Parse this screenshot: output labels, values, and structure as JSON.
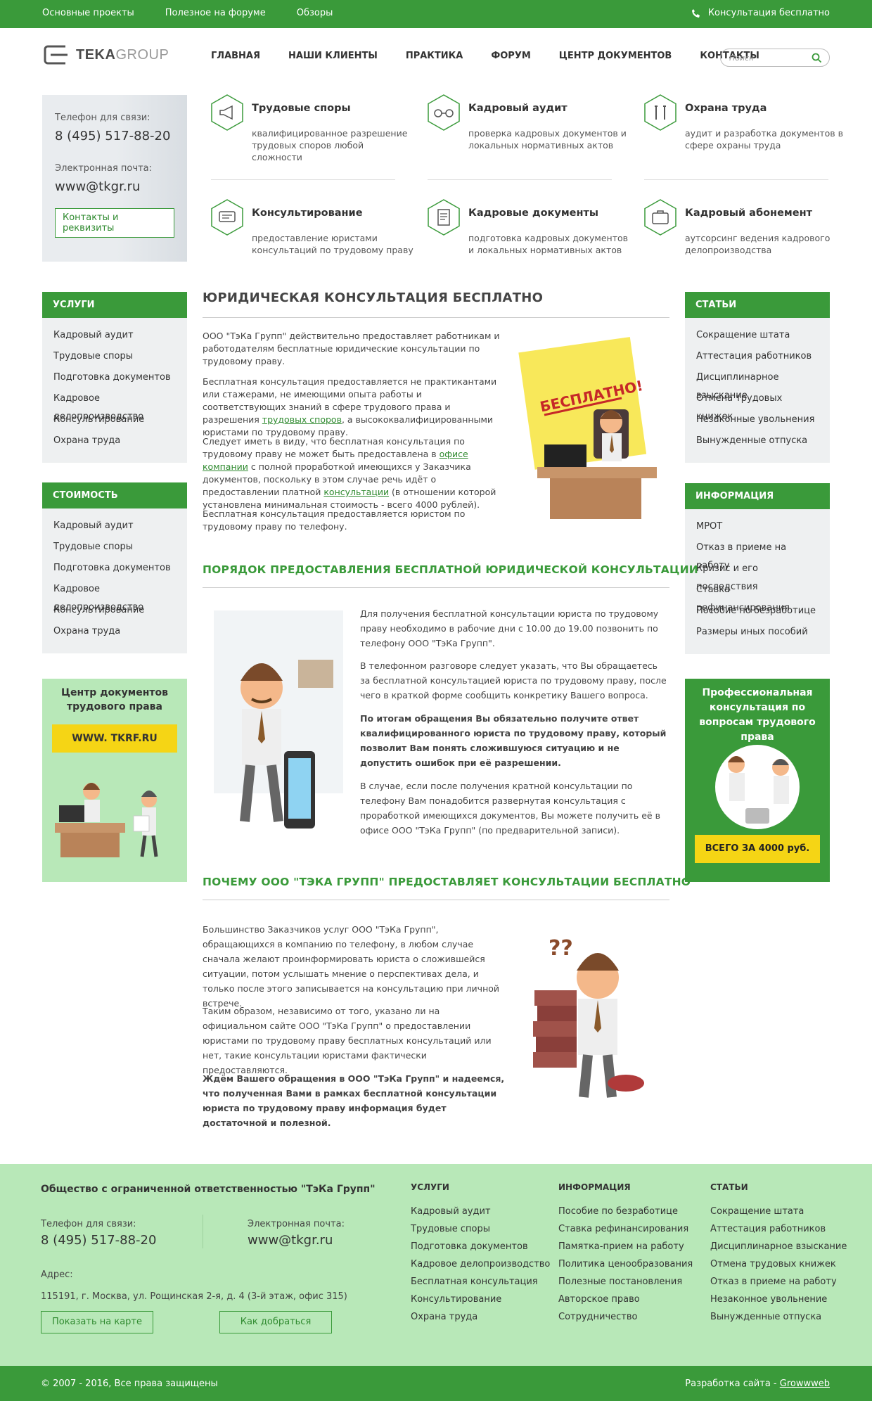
{
  "topbar": {
    "links": [
      "Основные проекты",
      "Полезное на форуме",
      "Обзоры"
    ],
    "consult": "Консультация бесплатно"
  },
  "logo": {
    "part1": "TEKA",
    "part2": "GROUP"
  },
  "nav": [
    "ГЛАВНАЯ",
    "НАШИ КЛИЕНТЫ",
    "ПРАКТИКА",
    "ФОРУМ",
    "ЦЕНТР ДОКУМЕНТОВ",
    "КОНТАКТЫ"
  ],
  "search": {
    "placeholder": "Поиск"
  },
  "contact": {
    "phone_label": "Телефон для связи:",
    "phone": "8 (495) 517-88-20",
    "email_label": "Электронная почта:",
    "email": "www@tkgr.ru",
    "button": "Контакты и реквизиты"
  },
  "services": [
    {
      "title": "Трудовые споры",
      "desc": "квалифицированное разрешение трудовых споров любой сложности",
      "icon": "megaphone-icon"
    },
    {
      "title": "Кадровый аудит",
      "desc": "проверка кадровых документов и локальных нормативных актов",
      "icon": "glasses-icon"
    },
    {
      "title": "Охрана труда",
      "desc": "аудит и разработка документов в сфере охраны труда",
      "icon": "tools-icon"
    },
    {
      "title": "Консультирование",
      "desc": "предоставление юристами консультаций по трудовому праву",
      "icon": "chat-icon"
    },
    {
      "title": "Кадровые документы",
      "desc": "подготовка кадровых документов и локальных нормативных актов",
      "icon": "document-icon"
    },
    {
      "title": "Кадровый абонемент",
      "desc": "аутсорсинг ведения кадрового делопроизводства",
      "icon": "briefcase-icon"
    }
  ],
  "left_sidebar": {
    "services": {
      "title": "УСЛУГИ",
      "items": [
        "Кадровый аудит",
        "Трудовые споры",
        "Подготовка документов",
        "Кадровое делопроизводство",
        "Консультирование",
        "Охрана труда"
      ]
    },
    "cost": {
      "title": "СТОИМОСТЬ",
      "items": [
        "Кадровый аудит",
        "Трудовые споры",
        "Подготовка документов",
        "Кадровое делопроизводство",
        "Консультирование",
        "Охрана труда"
      ]
    },
    "banner": {
      "title": "Центр документов трудового права",
      "site": "WWW. TKRF.RU"
    }
  },
  "right_sidebar": {
    "articles": {
      "title": "СТАТЬИ",
      "items": [
        "Сокращение штата",
        "Аттестация работников",
        "Дисциплинарное взыскание",
        "Отмена трудовых книжек",
        "Незаконные увольнения",
        "Вынужденные отпуска"
      ]
    },
    "info": {
      "title": "ИНФОРМАЦИЯ",
      "items": [
        "МРОТ",
        "Отказ в приеме на работу",
        "Кризис и его последствия",
        "Ставка рефинансирования",
        "Пособие по безработице",
        "Размеры иных пособий"
      ]
    },
    "banner": {
      "title": "Профессиональная консультация по вопросам трудового права",
      "price": "ВСЕГО ЗА 4000 руб."
    }
  },
  "article": {
    "title": "ЮРИДИЧЕСКАЯ КОНСУЛЬТАЦИЯ БЕСПЛАТНО",
    "sticker": "БЕСПЛАТНО!",
    "p1": "ООО \"ТэКа Групп\" действительно предоставляет работникам и работодателям бесплатные юридические консультации по трудовому праву.",
    "p2a": "Бесплатная консультация предоставляется не практикантами или стажерами, не имеющими опыта работы и соответствующих знаний в сфере трудового права и разрешения ",
    "p2link": "трудовых споров",
    "p2b": ", а высококвалифицированными юристами по трудовому праву.",
    "p3a": "Следует иметь в виду, что бесплатная консультация по трудовому праву не может быть предоставлена в ",
    "p3link1": "офисе компании",
    "p3b": " с полной проработкой имеющихся у Заказчика документов, поскольку в этом случае речь идёт о предоставлении платной ",
    "p3link2": "консультации",
    "p3c": " (в отношении которой установлена минимальная стоимость - всего 4000 рублей).",
    "p4": "Бесплатная консультация предоставляется юристом по трудовому праву по телефону.",
    "h2a": "ПОРЯДОК ПРЕДОСТАВЛЕНИЯ БЕСПЛАТНОЙ ЮРИДИЧЕСКОЙ КОНСУЛЬТАЦИИ",
    "p5": " Для получения бесплатной консультации юриста по трудовому праву необходимо в рабочие дни с 10.00 до 19.00 позвонить по телефону ООО \"ТэКа Групп\".",
    "p6": "В телефонном разговоре следует указать, что Вы обращаетесь за бесплатной консультацией юриста по трудовому праву, после чего в краткой форме сообщить конкретику Вашего вопроса.",
    "p7": "По итогам обращения Вы обязательно получите ответ квалифицированного юриста по трудовому праву, который позволит Вам понять сложившуюся ситуацию и не допустить ошибок при её разрешении.",
    "p8": "В случае, если после получения кратной консультации по телефону Вам понадобится развернутая консультация с проработкой имеющихся документов, Вы можете получить её в офисе ООО \"ТэКа Групп\" (по предварительной записи).",
    "h2b": "ПОЧЕМУ ООО \"ТЭКА ГРУПП\" ПРЕДОСТАВЛЯЕТ КОНСУЛЬТАЦИИ БЕСПЛАТНО",
    "p9": " Большинство Заказчиков услуг ООО \"ТэКа Групп\", обращающихся в компанию по телефону, в любом случае сначала желают проинформировать юриста о сложившейся ситуации, потом услышать мнение о перспективах  дела, и только после этого записывается на консультацию при личной встрече.",
    "p10": "Таким образом, независимо от того, указано ли на официальном сайте ООО \"ТэКа Групп\" о предоставлении юристами по трудовому праву бесплатных консультаций или нет, такие консультации юристами фактически предоставляются.",
    "p11": "Ждём Вашего обращения в ООО \"ТэКа Групп\" и надеемся, что полученная Вами в рамках бесплатной консультации юриста по трудовому праву информация будет достаточной и полезной."
  },
  "footer": {
    "company": "Общество с ограниченной ответственностью \"ТэКа Групп\"",
    "phone_label": "Телефон для связи:",
    "phone": "8 (495) 517-88-20",
    "email_label": "Электронная почта:",
    "email": "www@tkgr.ru",
    "address_label": "Адрес:",
    "address": "115191, г. Москва, ул. Рощинская 2-я, д. 4 (3-й этаж, офис 315)",
    "map_button": "Показать на карте",
    "route_button": "Как добраться",
    "col1": {
      "title": "УСЛУГИ",
      "items": [
        "Кадровый аудит",
        "Трудовые споры",
        "Подготовка документов",
        "Кадровое делопроизводство",
        "Бесплатная консультация",
        "Консультирование",
        "Охрана труда"
      ]
    },
    "col2": {
      "title": "ИНФОРМАЦИЯ",
      "items": [
        "Пособие по безработице",
        "Ставка рефинансирования",
        "Памятка-прием на работу",
        "Политика ценообразования",
        "Полезные постановления",
        "Авторское право",
        "Сотрудничество"
      ]
    },
    "col3": {
      "title": "СТАТЬИ",
      "items": [
        "Сокращение штата",
        "Аттестация работников",
        "Дисциплинарное взыскание",
        "Отмена трудовых книжек",
        "Отказ в приеме на работу",
        "Незаконное увольнение",
        "Вынужденные отпуска"
      ]
    }
  },
  "bottombar": {
    "copyright": "© 2007 - 2016, Все права защищены",
    "dev_label": "Разработка сайта - ",
    "dev_link": "Growwweb"
  },
  "colors": {
    "green": "#3a9a3a",
    "light_green": "#b8e8b8",
    "yellow": "#f5d515",
    "gray": "#eef0f1"
  }
}
